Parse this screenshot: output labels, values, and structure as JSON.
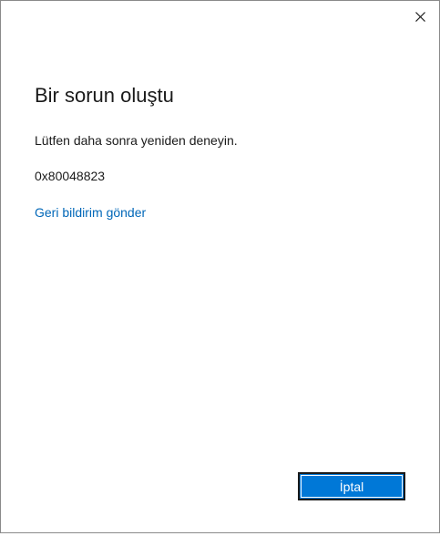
{
  "dialog": {
    "title": "Bir sorun oluştu",
    "message": "Lütfen daha sonra yeniden deneyin.",
    "error_code": "0x80048823",
    "feedback_link": "Geri bildirim gönder",
    "cancel_label": "İptal"
  },
  "icons": {
    "close": "close-icon"
  },
  "colors": {
    "accent": "#0078d7",
    "link": "#0067b8",
    "text": "#1a1a1a"
  }
}
